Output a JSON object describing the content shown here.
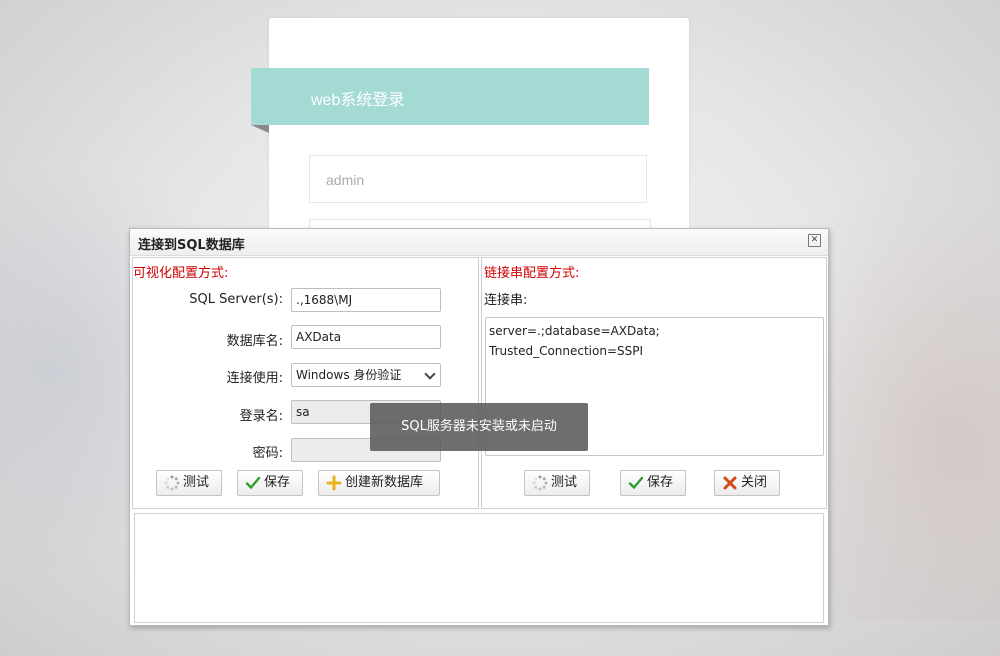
{
  "login": {
    "title": "web系统登录",
    "username_placeholder": "admin"
  },
  "dialog": {
    "title": "连接到SQL数据库",
    "close_icon": "close-icon",
    "visual_config": {
      "section_title": "可视化配置方式:",
      "server_label": "SQL Server(s):",
      "server_value": ".,1688\\MJ",
      "database_label": "数据库名:",
      "database_value": "AXData",
      "auth_label": "连接使用:",
      "auth_value": "Windows 身份验证",
      "login_label": "登录名:",
      "login_value": "sa",
      "password_label": "密码:",
      "password_value": "",
      "buttons": {
        "test": "测试",
        "save": "保存",
        "create_db": "创建新数据库"
      }
    },
    "string_config": {
      "section_title": "链接串配置方式:",
      "conn_label": "连接串:",
      "conn_value": "server=.;database=AXData;\nTrusted_Connection=SSPI",
      "buttons": {
        "test": "测试",
        "save": "保存",
        "close": "关闭"
      }
    }
  },
  "toast": {
    "message": "SQL服务器未安装或未启动"
  },
  "colors": {
    "banner": "#a3dbd4",
    "section_title": "#d00000",
    "save_check": "#2e9e2e",
    "close_x": "#d04a1a",
    "add_plus": "#e8b21c"
  }
}
